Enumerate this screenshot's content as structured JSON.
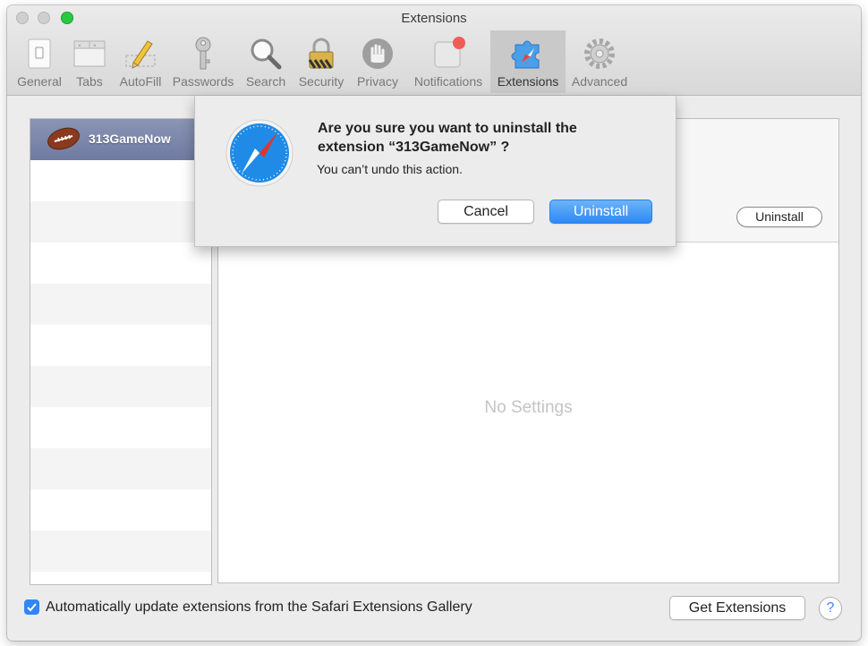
{
  "window": {
    "title": "Extensions"
  },
  "toolbar": {
    "items": [
      {
        "label": "General",
        "icon": "general-switch-icon"
      },
      {
        "label": "Tabs",
        "icon": "tabs-icon"
      },
      {
        "label": "AutoFill",
        "icon": "pencil-icon"
      },
      {
        "label": "Passwords",
        "icon": "key-icon"
      },
      {
        "label": "Search",
        "icon": "magnifier-icon"
      },
      {
        "label": "Security",
        "icon": "lock-icon"
      },
      {
        "label": "Privacy",
        "icon": "hand-icon"
      },
      {
        "label": "Notifications",
        "icon": "notification-badge-icon"
      },
      {
        "label": "Extensions",
        "icon": "puzzle-piece-icon",
        "selected": true
      },
      {
        "label": "Advanced",
        "icon": "gear-icon"
      }
    ]
  },
  "extensions_list": {
    "items": [
      {
        "name": "313GameNow",
        "icon": "football-icon",
        "selected": true
      }
    ]
  },
  "detail": {
    "uninstall_label": "Uninstall",
    "empty_label": "No Settings"
  },
  "footer": {
    "auto_update_label": "Automatically update extensions from the Safari Extensions Gallery",
    "auto_update_checked": true,
    "get_extensions_label": "Get Extensions",
    "help_label": "?"
  },
  "dialog": {
    "title": "Are you sure you want to uninstall the extension “313GameNow” ?",
    "message": "You can’t undo this action.",
    "cancel_label": "Cancel",
    "confirm_label": "Uninstall",
    "icon": "safari-compass-icon"
  },
  "colors": {
    "accent": "#2f86f5",
    "selected_row": "#7a85a9",
    "close_button": "#2ac840"
  }
}
